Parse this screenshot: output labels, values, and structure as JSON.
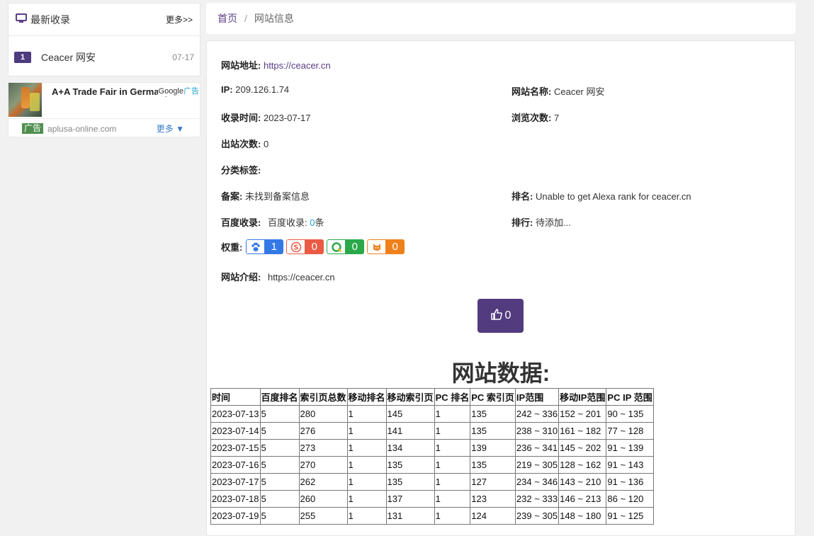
{
  "sidebar": {
    "title": "最新收录",
    "more": "更多>>",
    "items": [
      {
        "rank": "1",
        "name": "Ceacer 网安",
        "date": "07-17"
      }
    ]
  },
  "ad": {
    "title": "A+A Trade Fair in Germany",
    "google": "Google",
    "ad_label": "广告",
    "tag": "广告",
    "url": "aplusa-online.com",
    "more": "更多 ▼"
  },
  "breadcrumb": {
    "home": "首页",
    "sep": "/",
    "current": "网站信息"
  },
  "info": {
    "url_label": "网站地址:",
    "url": "https://ceacer.cn",
    "ip_label": "IP:",
    "ip": "209.126.1.74",
    "name_label": "网站名称:",
    "name": "Ceacer 网安",
    "time_label": "收录时间:",
    "time": "2023-07-17",
    "views_label": "浏览次数:",
    "views": "7",
    "out_label": "出站次数:",
    "out": "0",
    "tags_label": "分类标签:",
    "beian_label": "备案:",
    "beian": "未找到备案信息",
    "rank_label": "排名:",
    "rank": "Unable to get Alexa rank for ceacer.cn",
    "baidu_label": "百度收录:",
    "baidu_prefix": "百度收录: ",
    "baidu_count": "0",
    "baidu_suffix": "条",
    "order_label": "排行:",
    "order": "待添加...",
    "weight_label": "权重:",
    "weights": {
      "baidu": "1",
      "sogou": "0",
      "so360": "0",
      "shenma": "0"
    },
    "intro_label": "网站介绍:",
    "intro": "https://ceacer.cn"
  },
  "like": {
    "count": "0"
  },
  "data_section": {
    "title": "网站数据:",
    "headers": [
      "时间",
      "百度排名",
      "索引页总数",
      "移动排名",
      "移动索引页",
      "PC 排名",
      "PC 索引页",
      "IP范围",
      "移动IP范围",
      "PC IP 范围"
    ],
    "rows": [
      [
        "2023-07-13",
        "5",
        "280",
        "1",
        "145",
        "1",
        "135",
        "242 ~ 336",
        "152 ~ 201",
        "90 ~ 135"
      ],
      [
        "2023-07-14",
        "5",
        "276",
        "1",
        "141",
        "1",
        "135",
        "238 ~ 310",
        "161 ~ 182",
        "77 ~ 128"
      ],
      [
        "2023-07-15",
        "5",
        "273",
        "1",
        "134",
        "1",
        "139",
        "236 ~ 341",
        "145 ~ 202",
        "91 ~ 139"
      ],
      [
        "2023-07-16",
        "5",
        "270",
        "1",
        "135",
        "1",
        "135",
        "219 ~ 305",
        "128 ~ 162",
        "91 ~ 143"
      ],
      [
        "2023-07-17",
        "5",
        "262",
        "1",
        "135",
        "1",
        "127",
        "234 ~ 346",
        "143 ~ 210",
        "91 ~ 136"
      ],
      [
        "2023-07-18",
        "5",
        "260",
        "1",
        "137",
        "1",
        "123",
        "232 ~ 333",
        "146 ~ 213",
        "86 ~ 120"
      ],
      [
        "2023-07-19",
        "5",
        "255",
        "1",
        "131",
        "1",
        "124",
        "239 ~ 305",
        "148 ~ 180",
        "91 ~ 125"
      ]
    ]
  }
}
